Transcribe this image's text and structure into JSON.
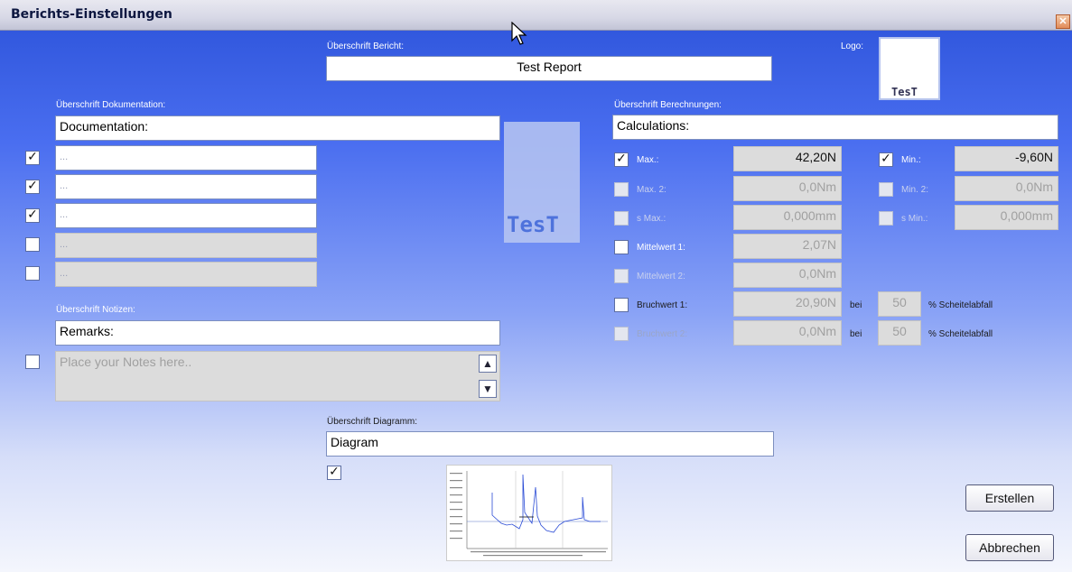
{
  "window": {
    "title": "Berichts-Einstellungen",
    "close_icon": "close-icon"
  },
  "report": {
    "heading_label": "Überschrift Bericht:",
    "heading_value": "Test Report",
    "logo_label": "Logo:",
    "logo_text": "TesT"
  },
  "documentation": {
    "heading_label": "Überschrift Dokumentation:",
    "heading_value": "Documentation:",
    "items": [
      {
        "checked": true,
        "value": "..."
      },
      {
        "checked": true,
        "value": "..."
      },
      {
        "checked": true,
        "value": "..."
      },
      {
        "checked": false,
        "value": "..."
      },
      {
        "checked": false,
        "value": "..."
      }
    ],
    "watermark_text": "TesT"
  },
  "notes": {
    "heading_label": "Überschrift Notizen:",
    "heading_value": "Remarks:",
    "checked": false,
    "placeholder": "Place your Notes here.."
  },
  "calculations": {
    "heading_label": "Überschrift Berechnungen:",
    "heading_value": "Calculations:",
    "rows": [
      {
        "label": "Max.:",
        "checked": true,
        "enabled": true,
        "value": "42,20N"
      },
      {
        "label": "Max. 2:",
        "checked": false,
        "enabled": false,
        "value": "0,0Nm"
      },
      {
        "label": "s Max.:",
        "checked": false,
        "enabled": false,
        "value": "0,000mm"
      },
      {
        "label": "Mittelwert 1:",
        "checked": false,
        "enabled": true,
        "value": "2,07N"
      },
      {
        "label": "Mittelwert 2:",
        "checked": false,
        "enabled": false,
        "value": "0,0Nm"
      },
      {
        "label": "Bruchwert 1:",
        "checked": false,
        "enabled": true,
        "value": "20,90N",
        "bei": "bei",
        "pct": "50",
        "suffix": "% Scheitelabfall"
      },
      {
        "label": "Bruchwert 2:",
        "checked": false,
        "enabled": false,
        "value": "0,0Nm",
        "bei": "bei",
        "pct": "50",
        "suffix": "% Scheitelabfall"
      }
    ],
    "min_rows": [
      {
        "label": "Min.:",
        "checked": true,
        "enabled": true,
        "value": "-9,60N"
      },
      {
        "label": "Min. 2:",
        "checked": false,
        "enabled": false,
        "value": "0,0Nm"
      },
      {
        "label": "s Min.:",
        "checked": false,
        "enabled": false,
        "value": "0,000mm"
      }
    ]
  },
  "diagram": {
    "heading_label": "Überschrift Diagramm:",
    "heading_value": "Diagram",
    "checked": true
  },
  "buttons": {
    "create": "Erstellen",
    "cancel": "Abbrechen"
  },
  "colors": {
    "accent": "#2b52d9"
  }
}
